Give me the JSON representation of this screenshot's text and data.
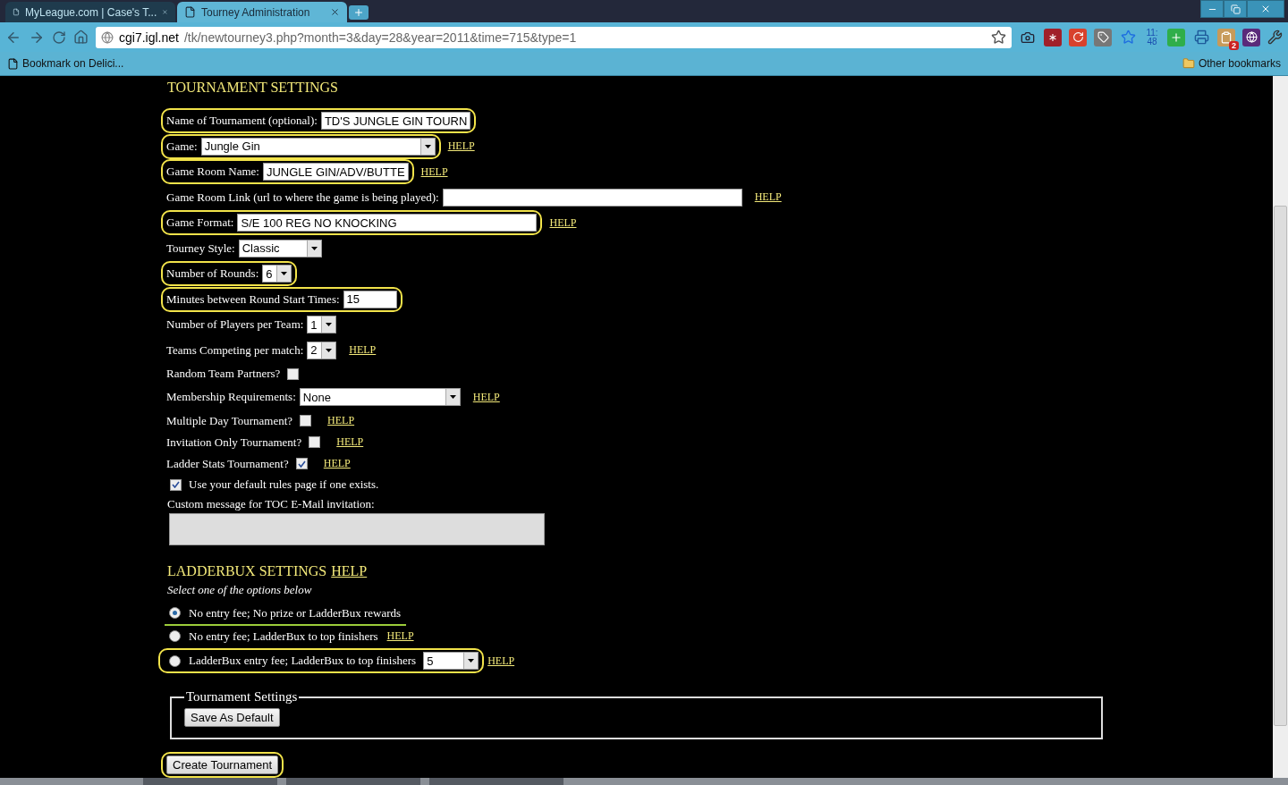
{
  "browser": {
    "tabs": [
      {
        "title": "MyLeague.com | Case's T...",
        "selected": false
      },
      {
        "title": "Tourney Administration",
        "selected": true
      }
    ],
    "url": {
      "host": "cgi7.igl.net",
      "path": "/tk/newtourney3.php?month=3&day=28&year=2011&time=715&type=1"
    },
    "clock_text": "11:48",
    "badge_count": "2",
    "bookmarks": [
      "Bookmark on Delici..."
    ],
    "other_bookmarks": "Other bookmarks"
  },
  "page": {
    "heading": "TOURNAMENT SETTINGS",
    "rows": [
      {
        "kind": "text",
        "label": "Name of Tournament (optional):",
        "value": "TD'S JUNGLE GIN TOURN",
        "highlighted": true
      },
      {
        "kind": "select",
        "label": "Game:",
        "value": "Jungle Gin",
        "help": "HELP",
        "highlighted": true
      },
      {
        "kind": "text",
        "label": "Game Room Name:",
        "value": "JUNGLE GIN/ADV/BUTTE",
        "help": "HELP",
        "highlighted": true
      },
      {
        "kind": "text",
        "label": "Game Room Link (url to where the game is being played):",
        "help": "HELP",
        "highlighted": false
      },
      {
        "kind": "text",
        "label": "Game Format:",
        "value": "S/E 100 REG NO KNOCKING",
        "help": "HELP",
        "highlighted": true
      },
      {
        "kind": "select",
        "label": "Tourney Style:",
        "value": "Classic",
        "highlighted": false
      },
      {
        "kind": "select",
        "label": "Number of Rounds:",
        "value": "6",
        "highlighted": true
      },
      {
        "kind": "text",
        "label": "Minutes between Round Start Times:",
        "value": "15",
        "highlighted": true
      },
      {
        "kind": "select",
        "label": "Number of Players per Team:",
        "value": "1",
        "highlighted": false
      },
      {
        "kind": "select",
        "label": "Teams Competing per match:",
        "value": "2",
        "help": "HELP",
        "highlighted": false
      },
      {
        "kind": "checkbox",
        "label": "Random Team Partners?",
        "checked": false,
        "highlighted": false
      },
      {
        "kind": "select",
        "label": "Membership Requirements:",
        "value": "None",
        "help": "HELP",
        "highlighted": false
      },
      {
        "kind": "checkbox",
        "label": "Multiple Day Tournament?",
        "checked": false,
        "help": "HELP",
        "highlighted": false
      },
      {
        "kind": "checkbox",
        "label": "Invitation Only Tournament?",
        "checked": false,
        "help": "HELP",
        "highlighted": false
      },
      {
        "kind": "checkbox",
        "label": "Ladder Stats Tournament?",
        "checked": true,
        "help": "HELP",
        "highlighted": false
      },
      {
        "kind": "checkfirst",
        "label": "Use your default rules page if one exists.",
        "checked": true,
        "highlighted": false
      },
      {
        "kind": "textarea",
        "label": "Custom message for TOC E-Mail invitation:",
        "highlighted": false
      }
    ],
    "ladderbux": {
      "heading": "LADDERBUX SETTINGS",
      "help": "HELP",
      "hint": "Select one of the options below",
      "options": [
        {
          "label": "No entry fee; No prize or LadderBux rewards",
          "selected": true,
          "underlined": true,
          "highlighted": false
        },
        {
          "label": "No entry fee; LadderBux to top finishers",
          "selected": false,
          "help": "HELP",
          "underlined": false,
          "highlighted": false
        },
        {
          "label": "LadderBux entry fee; LadderBux to top finishers",
          "selected": false,
          "value": "5",
          "help": "HELP",
          "underlined": false,
          "highlighted": true
        }
      ]
    },
    "fieldset": {
      "legend": "Tournament Settings",
      "button": "Save As Default"
    },
    "create_button": {
      "label": "Create Tournament",
      "highlighted": true
    }
  }
}
